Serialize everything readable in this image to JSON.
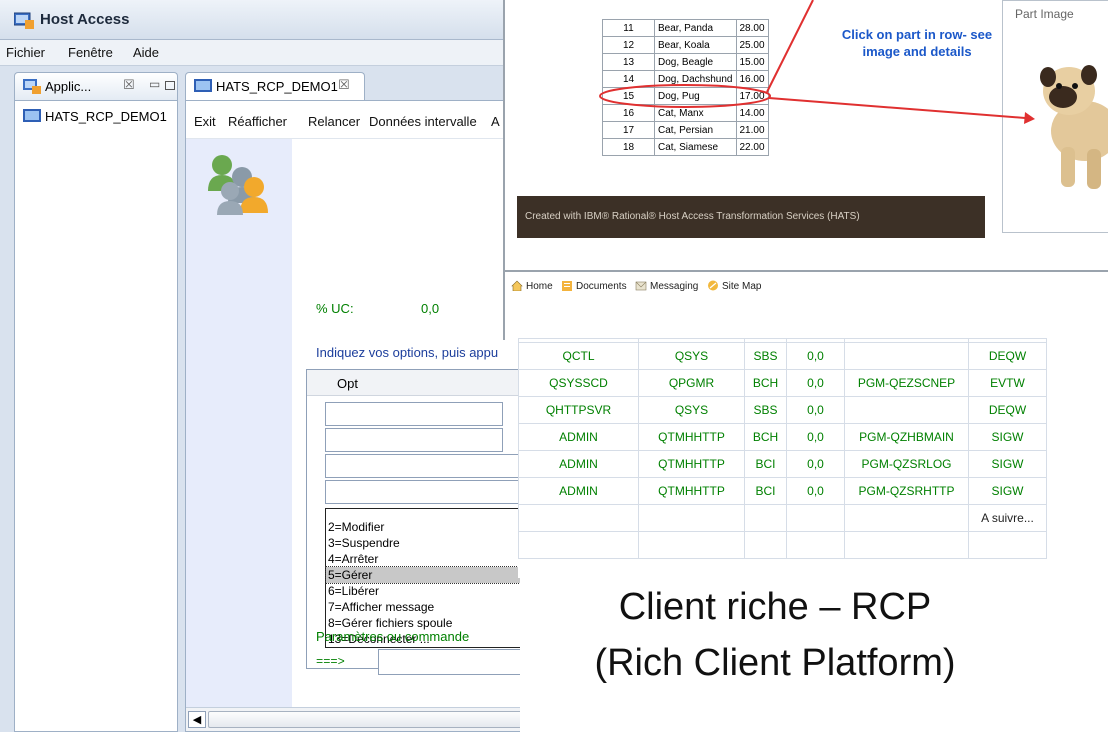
{
  "window": {
    "title": "Host Access"
  },
  "menu": [
    "Fichier",
    "Fenêtre",
    "Aide"
  ],
  "left_view": {
    "tab_label": "Applic...",
    "close_glyph": "☒",
    "tree_items": [
      "HATS_RCP_DEMO1"
    ]
  },
  "editor": {
    "tab_label": "HATS_RCP_DEMO1",
    "close_glyph": "☒",
    "actions": [
      "Exit",
      "Réafficher",
      "Relancer",
      "Données intervalle",
      "A"
    ]
  },
  "screen": {
    "cpu_label": "% UC:",
    "cpu_value": "0,0",
    "instructions": "Indiquez vos options, puis appu",
    "opt_header": "Opt",
    "dropdown_options": [
      "2=Modifier",
      "3=Suspendre",
      "4=Arrêter",
      "5=Gérer",
      "6=Libérer",
      "7=Afficher message",
      "8=Gérer fichiers spoule",
      "13=Déconnecter ..."
    ],
    "selected_option": "5=Gérer",
    "params_label": "Paramètres ou commande",
    "prompt": "===>"
  },
  "overlay": {
    "parts": [
      {
        "num": "11",
        "name": "Bear, Panda",
        "price": "28.00"
      },
      {
        "num": "12",
        "name": "Bear, Koala",
        "price": "25.00"
      },
      {
        "num": "13",
        "name": "Dog, Beagle",
        "price": "15.00"
      },
      {
        "num": "14",
        "name": "Dog, Dachshund",
        "price": "16.00"
      },
      {
        "num": "15",
        "name": "Dog, Pug",
        "price": "17.00"
      },
      {
        "num": "16",
        "name": "Cat, Manx",
        "price": "14.00"
      },
      {
        "num": "17",
        "name": "Cat, Persian",
        "price": "21.00"
      },
      {
        "num": "18",
        "name": "Cat, Siamese",
        "price": "22.00"
      }
    ],
    "highlighted_part": "15",
    "callout": "Click on part in row- see image and details",
    "part_image_label": "Part Image",
    "footer": "Created with IBM® Rational® Host Access Transformation Services (HATS)",
    "nav": [
      "Home",
      "Documents",
      "Messaging",
      "Site Map"
    ],
    "accent_color": "#1b58c9",
    "callout_line_color": "#e03030"
  },
  "jobs": [
    [
      "QCTL",
      "QSYS",
      "SBS",
      "0,0",
      "",
      "DEQW"
    ],
    [
      "QSYSSCD",
      "QPGMR",
      "BCH",
      "0,0",
      "PGM-QEZSCNEP",
      "EVTW"
    ],
    [
      "QHTTPSVR",
      "QSYS",
      "SBS",
      "0,0",
      "",
      "DEQW"
    ],
    [
      "ADMIN",
      "QTMHHTTP",
      "BCH",
      "0,0",
      "PGM-QZHBMAIN",
      "SIGW"
    ],
    [
      "ADMIN",
      "QTMHHTTP",
      "BCI",
      "0,0",
      "PGM-QZSRLOG",
      "SIGW"
    ],
    [
      "ADMIN",
      "QTMHHTTP",
      "BCI",
      "0,0",
      "PGM-QZSRHTTP",
      "SIGW"
    ]
  ],
  "more_label": "A suivre...",
  "caption": {
    "line1": "Client riche – RCP",
    "line2": "(Rich Client Platform)"
  },
  "colors": {
    "host_text_green": "#008000",
    "instruction_blue": "#1c3e9c",
    "side_panel": "#e7ecfb"
  }
}
